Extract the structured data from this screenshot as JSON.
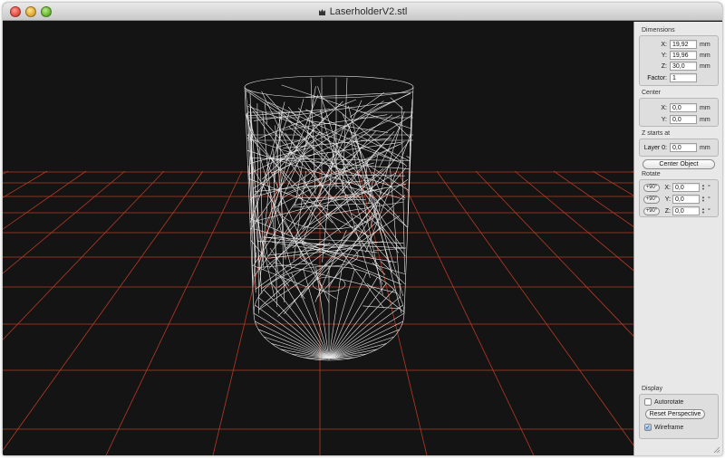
{
  "window": {
    "title": "LaserholderV2.stl",
    "viewport_bg": "#141414",
    "grid_color": "#b53a24",
    "wire_color": "#ffffff"
  },
  "panel": {
    "dimensions": {
      "title": "Dimensions",
      "x_label": "X:",
      "x_value": "19,92",
      "x_unit": "mm",
      "y_label": "Y:",
      "y_value": "19,96",
      "y_unit": "mm",
      "z_label": "Z:",
      "z_value": "30,0",
      "z_unit": "mm",
      "factor_label": "Factor:",
      "factor_value": "1"
    },
    "center": {
      "title": "Center",
      "x_label": "X:",
      "x_value": "0,0",
      "x_unit": "mm",
      "y_label": "Y:",
      "y_value": "0,0",
      "y_unit": "mm"
    },
    "z_start": {
      "title": "Z starts at",
      "layer_label": "Layer 0:",
      "layer_value": "0,0",
      "layer_unit": "mm"
    },
    "center_object_label": "Center Object",
    "rotate": {
      "title": "Rotate",
      "rows": [
        {
          "button": "+90°",
          "axis": "X:",
          "value": "0,0",
          "unit": "°"
        },
        {
          "button": "+90°",
          "axis": "Y:",
          "value": "0,0",
          "unit": "°"
        },
        {
          "button": "+90°",
          "axis": "Z:",
          "value": "0,0",
          "unit": "°"
        }
      ]
    },
    "display": {
      "title": "Display",
      "autorotate_label": "Autorotate",
      "autorotate_checked": false,
      "reset_label": "Reset Perspective",
      "wireframe_label": "Wireframe",
      "wireframe_checked": true
    }
  }
}
